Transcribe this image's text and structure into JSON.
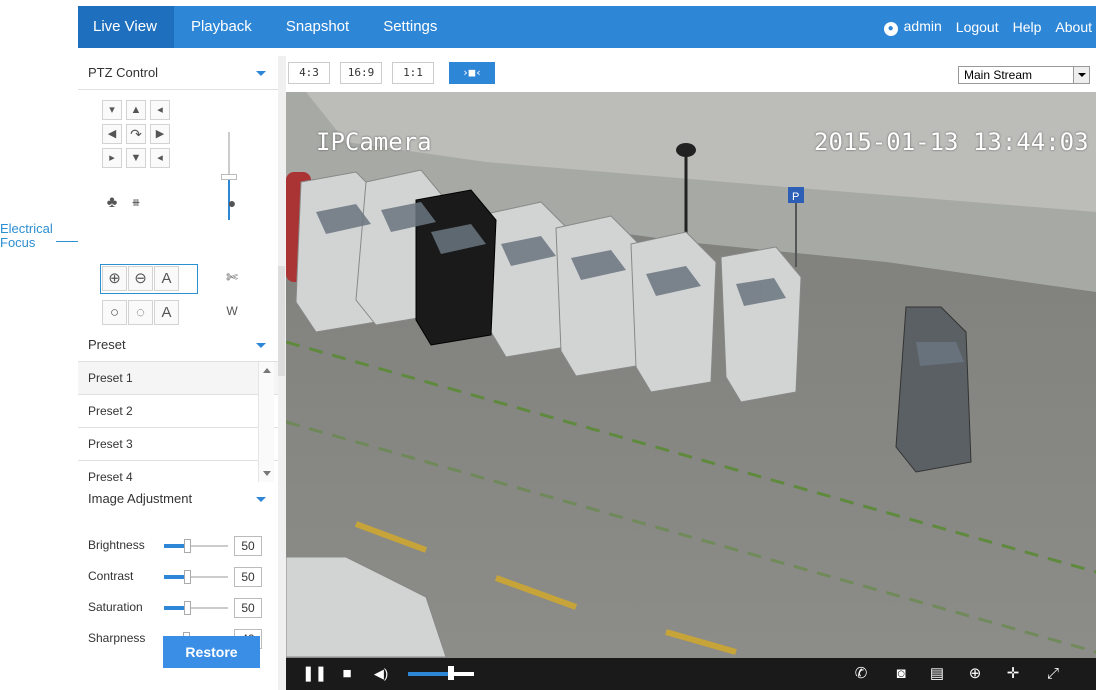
{
  "annotation": {
    "electrical_focus": "Electrical\nFocus"
  },
  "nav": {
    "tabs": [
      "Live View",
      "Playback",
      "Snapshot",
      "Settings"
    ],
    "user": "admin",
    "logout": "Logout",
    "help": "Help",
    "about": "About"
  },
  "ptz": {
    "title": "PTZ Control",
    "speed_level": 0.45
  },
  "preset": {
    "title": "Preset",
    "items": [
      "Preset 1",
      "Preset 2",
      "Preset 3",
      "Preset 4"
    ]
  },
  "image_adjustment": {
    "title": "Image Adjustment",
    "rows": [
      {
        "label": "Brightness",
        "value": "50"
      },
      {
        "label": "Contrast",
        "value": "50"
      },
      {
        "label": "Saturation",
        "value": "50"
      },
      {
        "label": "Sharpness",
        "value": "49"
      }
    ],
    "restore_label": "Restore"
  },
  "aspect": {
    "ratios": [
      "4:3",
      "16:9",
      "1:1"
    ],
    "stream": "Main Stream"
  },
  "video": {
    "osd_name": "IPCamera",
    "osd_time": "2015-01-13 13:44:03"
  },
  "controls": {
    "volume": 0.65
  },
  "colors": {
    "accent": "#2e86d6",
    "nav_active": "#1e6fbd",
    "ctrl_bg": "#1a1a1a"
  }
}
